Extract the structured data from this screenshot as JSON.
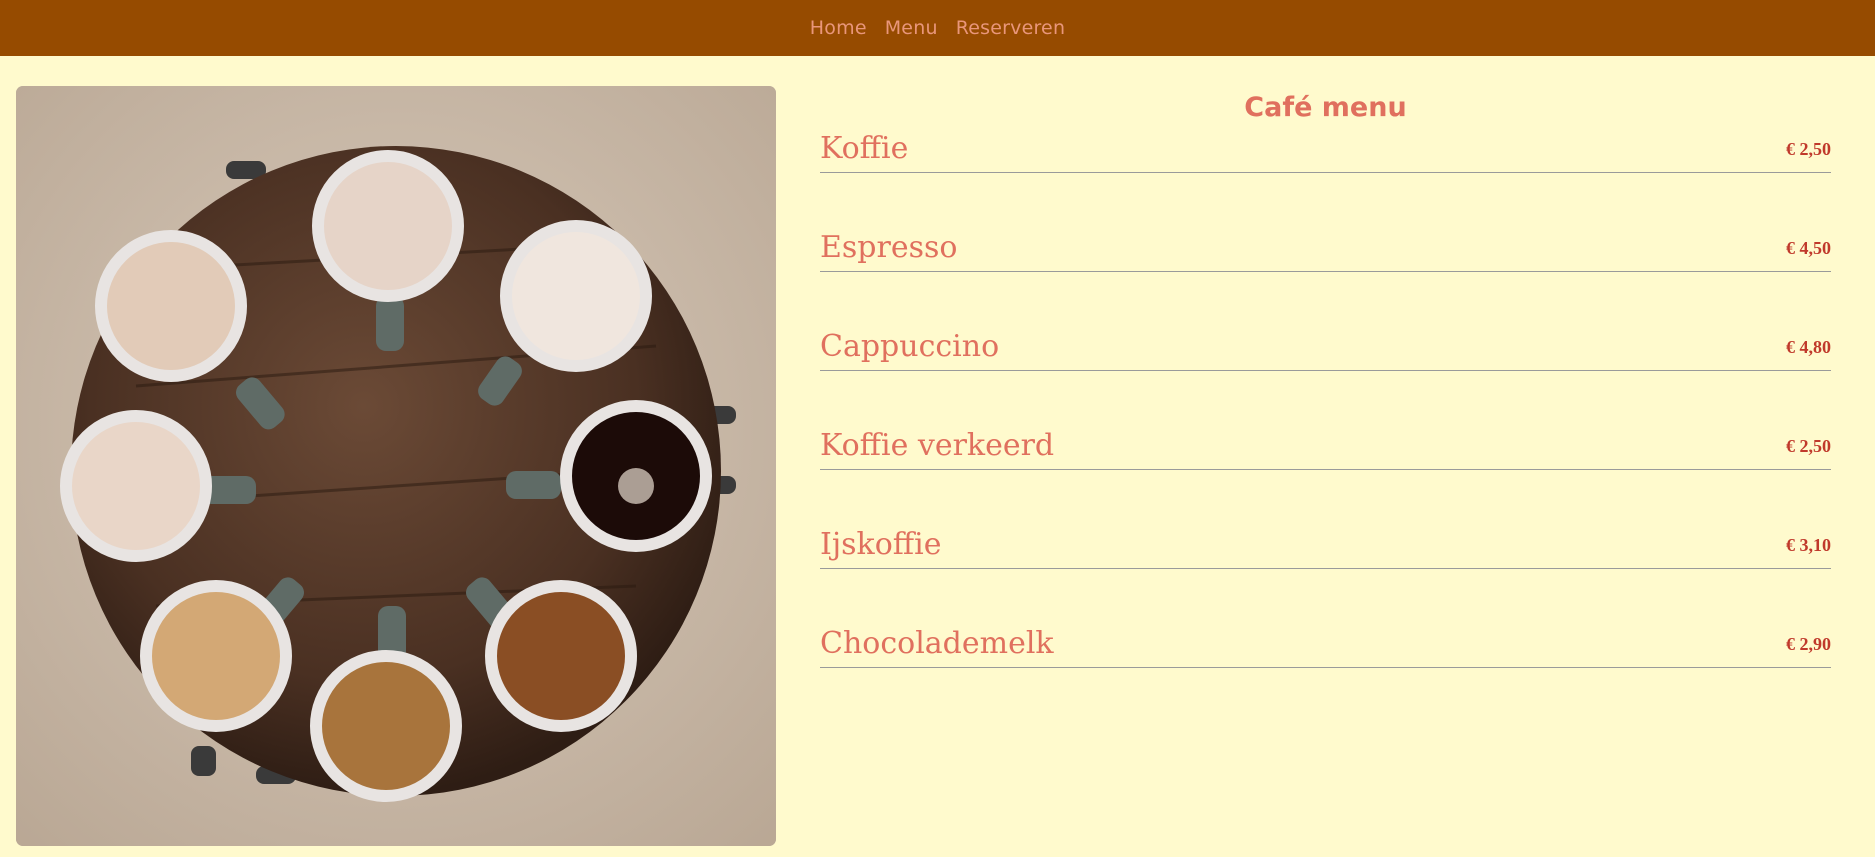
{
  "nav": {
    "items": [
      {
        "label": "Home"
      },
      {
        "label": "Menu"
      },
      {
        "label": "Reserveren"
      }
    ]
  },
  "colors": {
    "navbar": "#964b00",
    "background": "#fffacd",
    "accent": "#e0705e",
    "price": "#c0392b"
  },
  "menu": {
    "title": "Café menu",
    "items": [
      {
        "name": "Koffie",
        "price": "€ 2,50"
      },
      {
        "name": "Espresso",
        "price": "€ 4,50"
      },
      {
        "name": "Cappuccino",
        "price": "€ 4,80"
      },
      {
        "name": "Koffie verkeerd",
        "price": "€ 2,50"
      },
      {
        "name": "Ijskoffie",
        "price": "€ 3,10"
      },
      {
        "name": "Chocolademelk",
        "price": "€ 2,90"
      }
    ]
  }
}
